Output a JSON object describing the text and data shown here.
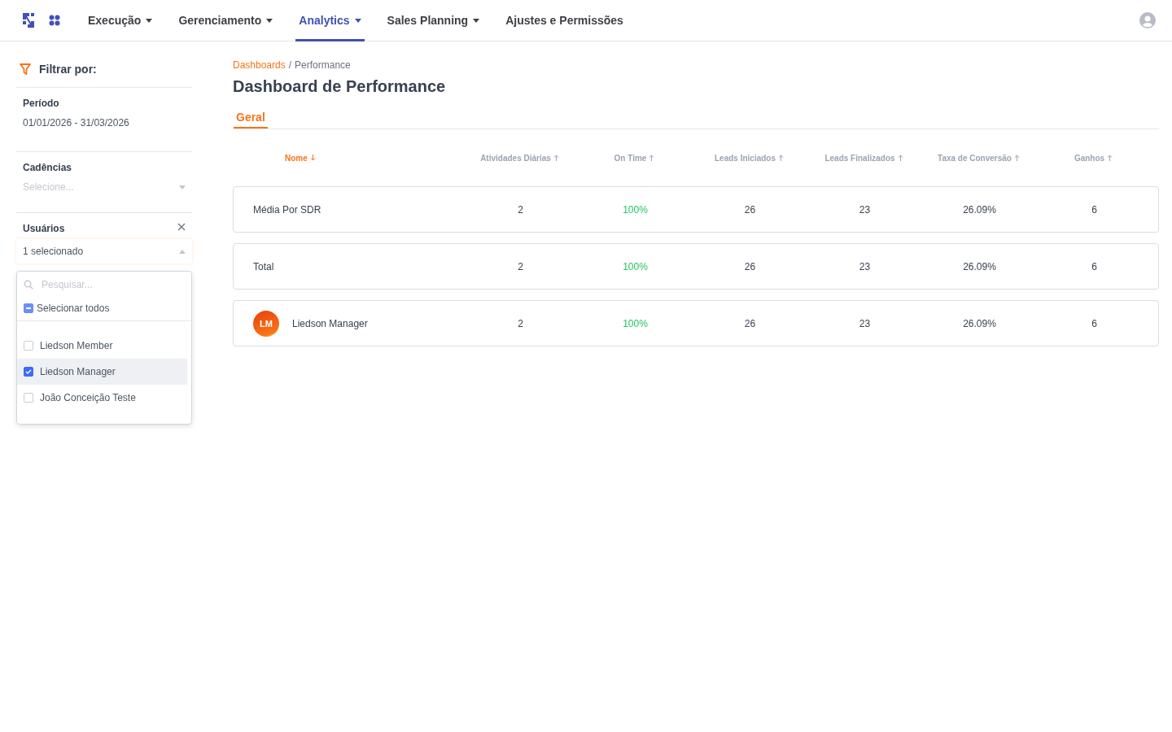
{
  "nav": {
    "items": [
      {
        "label": "Execução",
        "dropdown": true,
        "selected": false
      },
      {
        "label": "Gerenciamento",
        "dropdown": true,
        "selected": false
      },
      {
        "label": "Analytics",
        "dropdown": true,
        "selected": true
      },
      {
        "label": "Sales Planning",
        "dropdown": true,
        "selected": false
      },
      {
        "label": "Ajustes e Permissões",
        "dropdown": false,
        "selected": false
      }
    ]
  },
  "sidebar": {
    "title": "Filtrar por:",
    "period": {
      "label": "Período",
      "value": "01/01/2026 - 31/03/2026"
    },
    "cadences": {
      "label": "Cadências",
      "placeholder": "Selecione..."
    },
    "users": {
      "label": "Usuários",
      "value": "1 selecionado",
      "expanded": true,
      "search_placeholder": "Pesquisar...",
      "select_all": {
        "label": "Selecionar todos",
        "partial": true
      },
      "options": [
        {
          "label": "Liedson Member",
          "checked": false,
          "selected": false
        },
        {
          "label": "Liedson Manager",
          "checked": true,
          "selected": true
        },
        {
          "label": "João Conceição Teste",
          "checked": false,
          "selected": false
        }
      ]
    }
  },
  "breadcrumb": [
    "Dashboards",
    "Performance"
  ],
  "breadcrumb_separator": "/",
  "title": "Dashboard de Performance",
  "tabs": [
    {
      "label": "Geral",
      "selected": true
    }
  ],
  "table": {
    "columns": [
      {
        "label": "Nome",
        "descending": true,
        "active": true
      },
      {
        "label": "Atividades Diárias",
        "descending": false,
        "active": false
      },
      {
        "label": "On Time",
        "descending": false,
        "active": false
      },
      {
        "label": "Leads Iniciados",
        "descending": false,
        "active": false
      },
      {
        "label": "Leads Finalizados",
        "descending": false,
        "active": false
      },
      {
        "label": "Taxa de Conversão",
        "descending": false,
        "active": false
      },
      {
        "label": "Ganhos",
        "descending": false,
        "active": false
      }
    ],
    "rows": [
      {
        "kind": "summary",
        "cells": [
          "Média Por SDR",
          "2",
          "100%",
          "26",
          "23",
          "26.09%",
          "6"
        ]
      },
      {
        "kind": "summary",
        "cells": [
          "Total",
          "2",
          "100%",
          "26",
          "23",
          "26.09%",
          "6"
        ]
      },
      {
        "kind": "user",
        "avatar": "LM",
        "cells": [
          "Liedson Manager",
          "2",
          "100%",
          "26",
          "23",
          "26.09%",
          "6"
        ]
      }
    ]
  }
}
